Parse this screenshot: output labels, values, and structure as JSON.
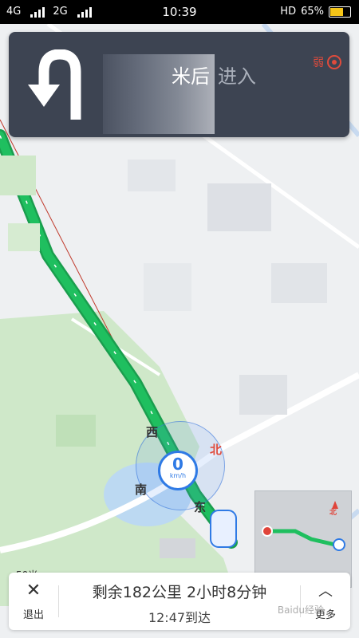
{
  "status": {
    "network1": "4G",
    "network2": "2G",
    "time": "10:39",
    "hd": "HD",
    "battery": "65%",
    "battery_level": 0.65
  },
  "nav_card": {
    "maneuver_icon": "u-turn-left-arrow-icon",
    "distance_suffix": "米后",
    "action": "进入",
    "gps_signal": "弱",
    "gps_icon": "gps-weak-icon"
  },
  "map": {
    "compass_labels": {
      "north": "北",
      "west": "西",
      "south": "南",
      "east": "东"
    },
    "speed_value": "0",
    "speed_unit": "km/h",
    "scale_label": "50米",
    "minimap_north": "北"
  },
  "bottom_bar": {
    "exit_label": "退出",
    "remaining": "剩余182公里 2小时8分钟",
    "arrival": "12:47到达",
    "more_label": "更多"
  },
  "colors": {
    "route": "#1fbf5f",
    "card_bg": "#3d4452",
    "accent_blue": "#2f7ae5",
    "alert_red": "#e04b3c"
  },
  "watermark": "Baidu经验"
}
